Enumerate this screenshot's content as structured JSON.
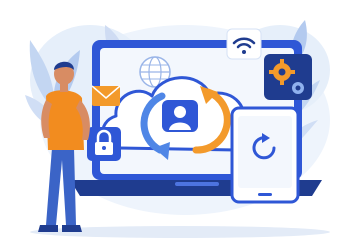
{
  "illustration": {
    "subject": "cloud-sync-illustration",
    "colors": {
      "primary_blue": "#2f57d6",
      "dark_blue": "#1f3c8f",
      "orange": "#f39a2b",
      "orange_light": "#f8b743",
      "background_blob": "#e9f1fb",
      "leaf_blue": "#b9d0f3",
      "skin": "#d88c63",
      "shirt": "#f28c1f",
      "jeans": "#3b64c7"
    },
    "icons": [
      "wifi-icon",
      "gear-icon",
      "globe-icon",
      "mail-icon",
      "lock-icon",
      "user-icon",
      "sync-icon",
      "smartphone-icon"
    ]
  }
}
